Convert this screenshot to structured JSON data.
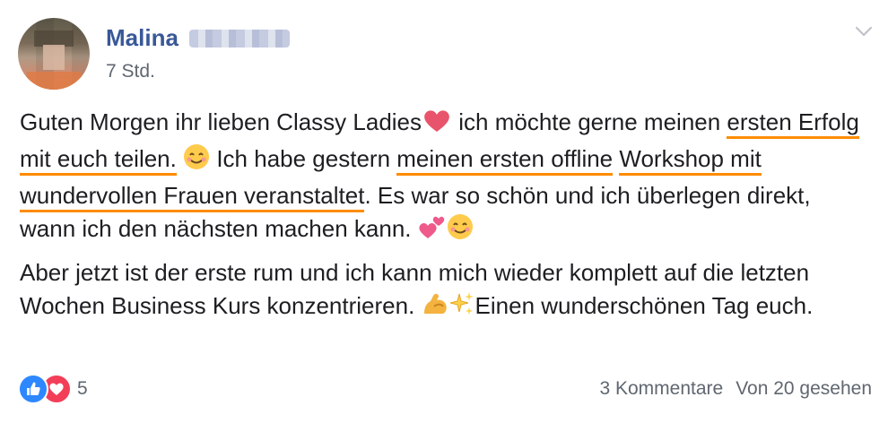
{
  "post": {
    "author": "Malina",
    "timestamp": "7 Std.",
    "text": {
      "p1_a": "Guten Morgen ihr lieben Classy Ladies",
      "p1_b": " ich möchte gerne meinen ",
      "p1_hl1": "ersten Erfolg mit euch teilen.",
      "p1_c": " Ich habe gestern ",
      "p1_hl2a": "meinen ersten offline",
      "p1_hl2b": "Workshop mit wundervollen Frauen veranstaltet",
      "p1_d": ". Es war so schön und ich überlegen direkt, wann ich den nächsten machen kann. ",
      "p2_a": "Aber jetzt ist der erste rum und ich kann mich wieder komplett auf die letzten Wochen Business Kurs konzentrieren. ",
      "p2_b": "Einen wunderschönen Tag euch."
    },
    "emojis": [
      "heart-emoji",
      "smiling-face-emoji",
      "two-hearts-emoji",
      "smiling-face-emoji",
      "flexed-biceps-emoji",
      "sparkles-emoji"
    ],
    "highlight_color": "#ff8c00",
    "name_color": "#385898"
  },
  "footer": {
    "reaction_icons": [
      "like-icon",
      "love-icon"
    ],
    "reaction_count": "5",
    "comments": "3 Kommentare",
    "seen": "Von 20 gesehen"
  }
}
